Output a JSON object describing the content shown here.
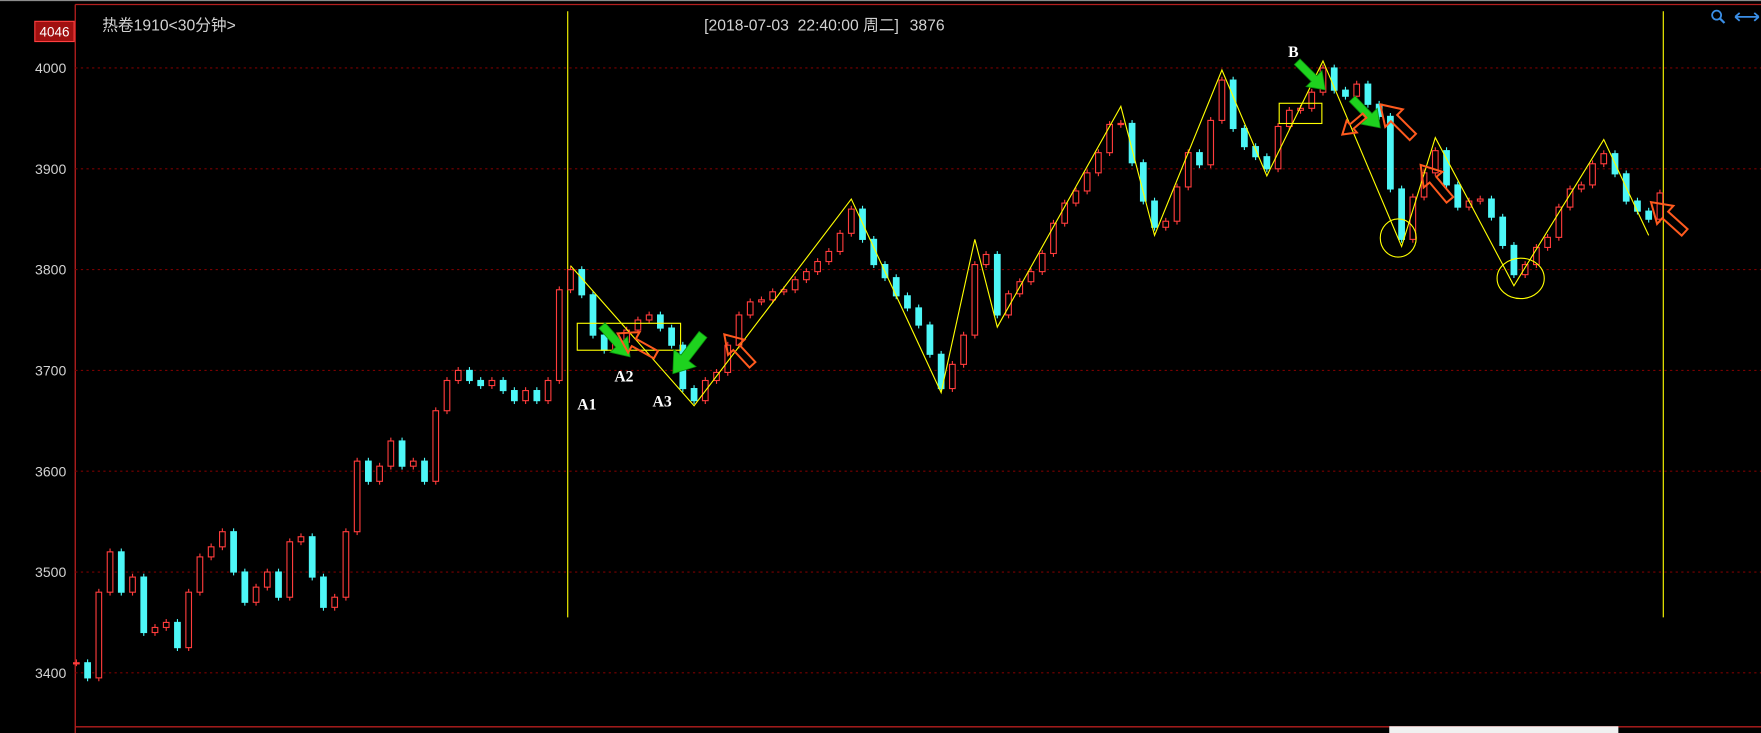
{
  "window": {
    "toolbar_icons": [
      "zoom-icon",
      "scroll-arrows-icon"
    ],
    "colors": {
      "background": "#000000",
      "axis": "#b41e1e",
      "grid": "#7a0000",
      "text": "#d2d2d2",
      "up_candle": "#ff3c3c",
      "down_candle": "#4df7f7",
      "drawing_yellow": "#ffff00",
      "arrow_green": "#1ed21e",
      "arrow_orange": "#ff5a1e",
      "label": "#ffffff",
      "icon": "#3a8ee6",
      "price_marker_bg": "#a01010"
    }
  },
  "chart_data": {
    "type": "bar",
    "title": "热卷1910<30分钟>",
    "cursor_time": "[2018-07-03  22:40:00 周二]",
    "cursor_value": "3876",
    "axis_max_label": "4046",
    "ylim": [
      3347,
      4063
    ],
    "yticks": [
      4000,
      3900,
      3800,
      3700,
      3600,
      3500,
      3400
    ],
    "grid": true,
    "close": [
      3410,
      3395,
      3480,
      3520,
      3480,
      3495,
      3440,
      3445,
      3450,
      3425,
      3480,
      3515,
      3525,
      3540,
      3500,
      3470,
      3485,
      3500,
      3475,
      3530,
      3535,
      3495,
      3465,
      3475,
      3540,
      3610,
      3590,
      3605,
      3630,
      3605,
      3610,
      3590,
      3660,
      3690,
      3700,
      3690,
      3685,
      3690,
      3680,
      3670,
      3680,
      3670,
      3690,
      3780,
      3800,
      3775,
      3735,
      3720,
      3728,
      3740,
      3750,
      3755,
      3742,
      3725,
      3682,
      3670,
      3690,
      3698,
      3725,
      3755,
      3768,
      3770,
      3778,
      3780,
      3790,
      3798,
      3808,
      3818,
      3836,
      3860,
      3830,
      3805,
      3792,
      3774,
      3762,
      3745,
      3716,
      3682,
      3706,
      3735,
      3805,
      3815,
      3755,
      3776,
      3788,
      3798,
      3816,
      3846,
      3866,
      3878,
      3896,
      3916,
      3944,
      3945,
      3906,
      3868,
      3842,
      3848,
      3882,
      3916,
      3904,
      3948,
      3988,
      3940,
      3922,
      3912,
      3900,
      3942,
      3958,
      3960,
      3976,
      4000,
      3978,
      3972,
      3984,
      3964,
      3952,
      3880,
      3830,
      3872,
      3896,
      3918,
      3884,
      3862,
      3868,
      3870,
      3852,
      3824,
      3795,
      3805,
      3822,
      3832,
      3862,
      3880,
      3884,
      3905,
      3915,
      3895,
      3868,
      3858,
      3850,
      3876
    ],
    "zigzag": [
      [
        44,
        3804
      ],
      [
        55,
        3665
      ],
      [
        69,
        3870
      ],
      [
        77,
        3678
      ],
      [
        80,
        3830
      ],
      [
        82,
        3743
      ],
      [
        93,
        3962
      ],
      [
        96,
        3834
      ],
      [
        102,
        3998
      ],
      [
        106,
        3893
      ],
      [
        111,
        4007
      ],
      [
        118,
        3823
      ],
      [
        121,
        3931
      ],
      [
        128,
        3784
      ],
      [
        136,
        3929
      ],
      [
        140,
        3834
      ]
    ],
    "annotation_labels": {
      "a1": "A1",
      "a2": "A2",
      "a3": "A3",
      "b": "B"
    }
  }
}
